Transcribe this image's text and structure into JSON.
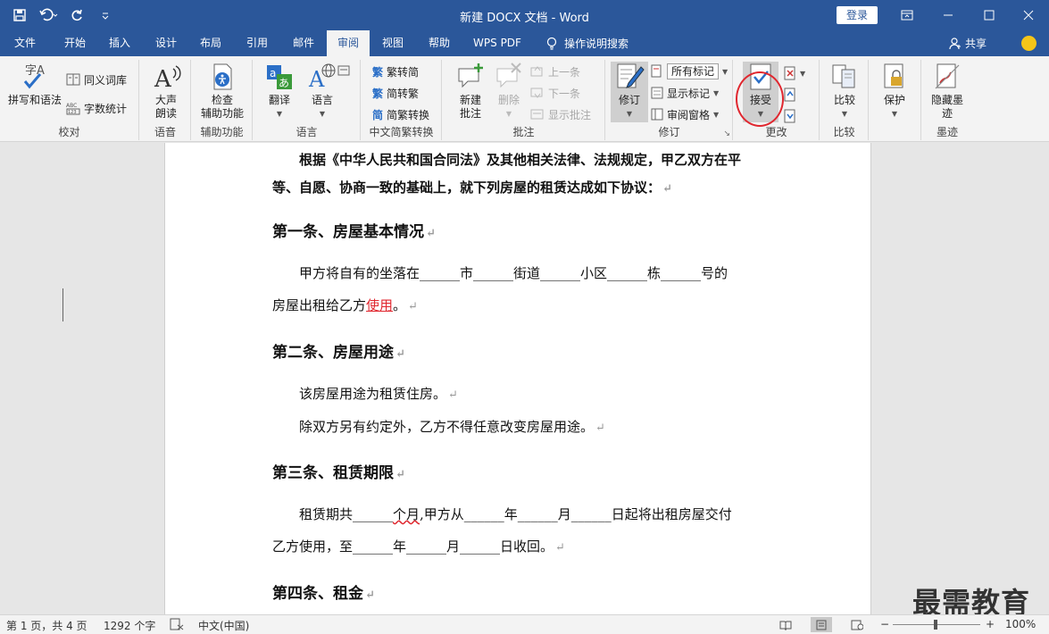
{
  "titlebar": {
    "title": "新建 DOCX 文档  -  Word",
    "login": "登录"
  },
  "tabs": [
    "文件",
    "开始",
    "插入",
    "设计",
    "布局",
    "引用",
    "邮件",
    "审阅",
    "视图",
    "帮助",
    "WPS PDF"
  ],
  "active_tab": "审阅",
  "tell_me": "操作说明搜索",
  "share": "共享",
  "ribbon": {
    "proofing": {
      "label": "校对",
      "spell": "拼写和语法",
      "thesaurus": "同义词库",
      "wordcount": "字数统计",
      "spell_icon_text": "字A"
    },
    "speech": {
      "label": "语音",
      "read_aloud_1": "大声",
      "read_aloud_2": "朗读"
    },
    "accessibility": {
      "label": "辅助功能",
      "check_1": "检查",
      "check_2": "辅助功能"
    },
    "language": {
      "label": "语言",
      "translate": "翻译",
      "language": "语言"
    },
    "chinese": {
      "label": "中文简繁转换",
      "to_simp": "繁转简",
      "to_trad": "简转繁",
      "convert": "简繁转换"
    },
    "comments": {
      "label": "批注",
      "new_1": "新建",
      "new_2": "批注",
      "delete": "删除",
      "prev": "上一条",
      "next": "下一条",
      "show": "显示批注"
    },
    "tracking": {
      "label": "修订",
      "track": "修订",
      "markup_value": "所有标记",
      "show_markup": "显示标记",
      "review_pane": "审阅窗格"
    },
    "changes": {
      "label": "更改",
      "accept": "接受"
    },
    "compare": {
      "label": "比较",
      "compare": "比较"
    },
    "protect": {
      "label": "",
      "protect": "保护"
    },
    "ink": {
      "label": "墨迹",
      "hide_1": "隐藏墨",
      "hide_2": "迹"
    }
  },
  "document": {
    "p1_line1": "根据《中华人民共和国合同法》及其他相关法律、法规规定，甲乙双方在平",
    "p1_line2": "等、自愿、协商一致的基础上，就下列房屋的租赁达成如下协议：",
    "h1": "第一条、房屋基本情况",
    "p2_line1": "甲方将自有的坐落在______市______街道______小区______栋______号的",
    "p2_line2a": "房屋出租给乙方",
    "p2_line2b": "使用",
    "p2_line2c": "。",
    "h2": "第二条、房屋用途",
    "p3": "该房屋用途为租赁住房。",
    "p4": "除双方另有约定外，乙方不得任意改变房屋用途。",
    "h3": "第三条、租赁期限",
    "p5_line1a": "租赁期共______",
    "p5_line1b": "个月",
    "p5_line1c": ",甲方从______年______月______日起将出租房屋交付",
    "p5_line2": "乙方使用，至______年______月______日收回。",
    "h4": "第四条、租金",
    "para_mark": "↵"
  },
  "watermark": "最需教育",
  "status": {
    "page": "第 1 页，共 4 页",
    "words": "1292 个字",
    "language": "中文(中国)",
    "zoom": "100%",
    "minus": "−",
    "plus": "+"
  }
}
